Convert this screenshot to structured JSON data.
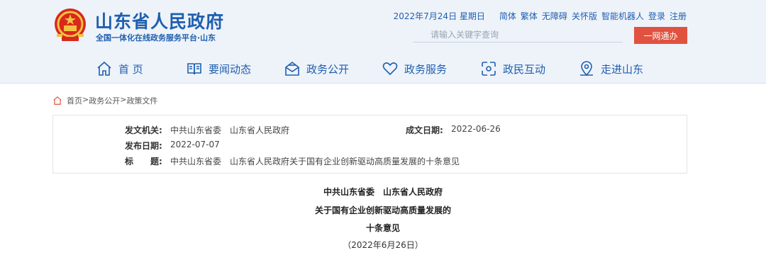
{
  "header": {
    "title": "山东省人民政府",
    "subtitle": "全国一体化在线政务服务平台·山东",
    "date": "2022年7月24日 星期日",
    "links": [
      "简体",
      "繁体",
      "无障碍",
      "关怀版",
      "智能机器人",
      "登录",
      "注册"
    ],
    "search_placeholder": "请输入关键字查询",
    "search_button": "一网通办"
  },
  "nav": [
    {
      "label": "首 页",
      "icon": "home-icon"
    },
    {
      "label": "要闻动态",
      "icon": "news-icon"
    },
    {
      "label": "政务公开",
      "icon": "mail-icon"
    },
    {
      "label": "政务服务",
      "icon": "heart-icon"
    },
    {
      "label": "政民互动",
      "icon": "interaction-icon"
    },
    {
      "label": "走进山东",
      "icon": "location-icon"
    }
  ],
  "breadcrumb": {
    "icon": "home-icon",
    "items": [
      "首页",
      ">",
      "政务公开",
      ">",
      "政策文件"
    ]
  },
  "meta": {
    "issuer_label": "发文机关:",
    "issuer": "中共山东省委　山东省人民政府",
    "written_label": "成文日期:",
    "written": "2022-06-26",
    "published_label": "发布日期:",
    "published": "2022-07-07",
    "title_label": "标　　题:",
    "title": "中共山东省委　山东省人民政府关于国有企业创新驱动高质量发展的十条意见"
  },
  "document": {
    "line1": "中共山东省委　山东省人民政府",
    "line2": "关于国有企业创新驱动高质量发展的",
    "line3": "十条意见",
    "date": "（2022年6月26日）"
  },
  "colors": {
    "brand_blue": "#1f5fae",
    "header_bg": "#eef3fa",
    "button_red": "#e0523f"
  }
}
